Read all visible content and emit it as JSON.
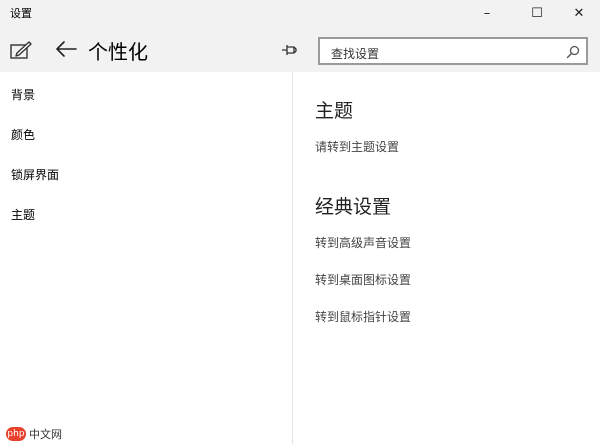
{
  "window": {
    "title": "设置",
    "controls": {
      "minimize": "–",
      "maximize": "☐",
      "close": "✕"
    }
  },
  "header": {
    "edit_icon": "edit-settings-icon",
    "back_icon": "back-arrow-icon",
    "title": "个性化",
    "pin_icon": "pin-icon"
  },
  "search": {
    "placeholder": "查找设置",
    "icon": "search-icon"
  },
  "sidebar": {
    "items": [
      {
        "label": "背景"
      },
      {
        "label": "颜色"
      },
      {
        "label": "锁屏界面"
      },
      {
        "label": "主题"
      }
    ]
  },
  "main": {
    "theme_section": {
      "title": "主题",
      "link": "请转到主题设置"
    },
    "classic_section": {
      "title": "经典设置",
      "links": [
        {
          "label": "转到高级声音设置"
        },
        {
          "label": "转到桌面图标设置"
        },
        {
          "label": "转到鼠标指针设置"
        }
      ]
    }
  },
  "watermark": {
    "logo": "php",
    "text": "中文网"
  },
  "colors": {
    "header_bg": "#f2f2f2",
    "content_bg": "#ffffff",
    "search_border": "#9a9a9a"
  }
}
